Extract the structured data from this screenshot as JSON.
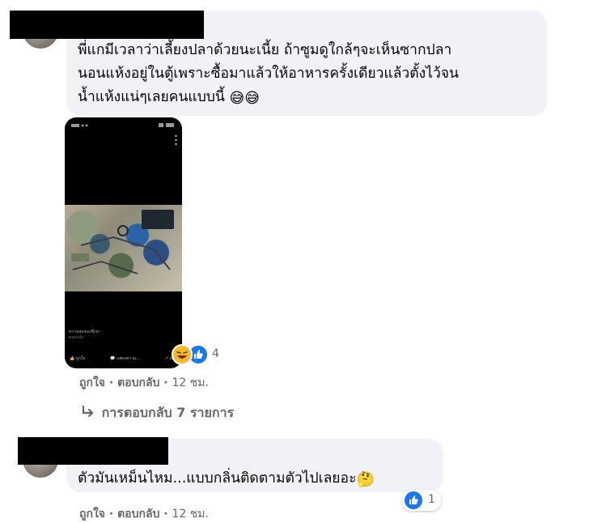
{
  "comments": [
    {
      "lines": [
        "พี่แกมีเวลาว่าเลี้ยงปลาด้วยนะเนี้ย ถ้าซูมดูใกล้ๆจะเห็นซากปลา",
        "นอนแห้งอยู่ในตู้เพราะซื้อมาแล้วให้อาหารครั้งเดียวแล้วตั้งไว้จน",
        "น้ำแห้งแน่ๆเลยคนแบบนี้"
      ],
      "trailing_emojis": "😅😅",
      "reaction_count": "4",
      "like_label": "ถูกใจ",
      "reply_label": "ตอบกลับ",
      "separator": "·",
      "time": "12 ชม.",
      "replies_label": "การตอบกลับ 7 รายการ",
      "attachment_caption": "ความสุขของพี่เขา",
      "attachment_sub": "ตอบกลับ",
      "attachment_actions": [
        "ถูกใจ",
        "แสดงความ...",
        "แชร์"
      ]
    },
    {
      "text": "ตัวมันเหม็นไหม...แบบกลิ่นติดตามตัวไปเลยอะ",
      "trailing_emoji": "🤔",
      "reaction_count": "1",
      "like_label": "ถูกใจ",
      "reply_label": "ตอบกลับ",
      "separator": "·",
      "time": "12 ชม."
    }
  ],
  "icons": {
    "laugh": "laugh-reaction-icon",
    "like": "like-reaction-icon",
    "reply_arrow": "reply-arrow-icon"
  },
  "colors": {
    "bubble": "#f0f2f5",
    "meta_text": "#65676b",
    "like_blue": "#1877f2",
    "laugh_yellow": "#f7b928"
  }
}
